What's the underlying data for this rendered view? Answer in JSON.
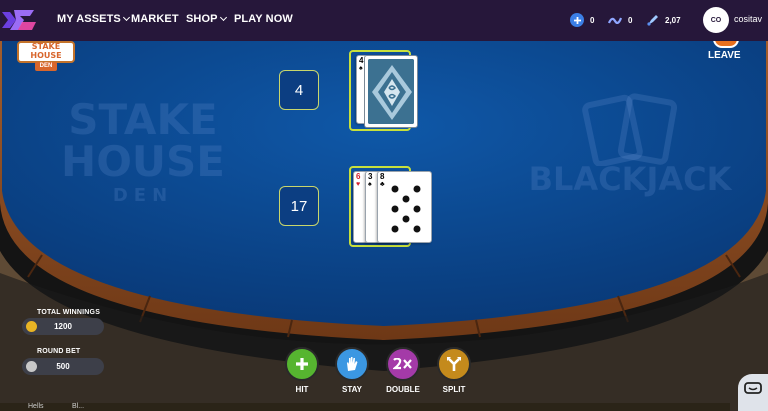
{
  "nav": {
    "items": [
      {
        "label": "MY ASSETS",
        "dropdown": true
      },
      {
        "label": "MARKET",
        "dropdown": false
      },
      {
        "label": "SHOP",
        "dropdown": true
      },
      {
        "label": "PLAY NOW",
        "dropdown": false
      }
    ],
    "stats": [
      {
        "icon": "plus-coin-icon",
        "value": "0"
      },
      {
        "icon": "wave-token-icon",
        "value": "0"
      },
      {
        "icon": "rocket-token-icon",
        "value": "2,07"
      }
    ],
    "avatar_initials": "CO",
    "username": "cositav"
  },
  "table": {
    "left_logo_lines": [
      "STAKE",
      "HOUSE",
      "DEN"
    ],
    "right_logo_text": "BLACKJACK",
    "small_logo_lines": [
      "STAKE",
      "HOUSE",
      "DEN"
    ],
    "leave_label": "LEAVE",
    "dealer": {
      "score": "4",
      "cards": [
        {
          "rank": "4",
          "suit": "♠",
          "color": "#111111",
          "face_down": false
        },
        {
          "face_down": true
        }
      ]
    },
    "player": {
      "score": "17",
      "cards": [
        {
          "rank": "6",
          "suit": "♥",
          "color": "#d41f2b"
        },
        {
          "rank": "3",
          "suit": "♠",
          "color": "#111111"
        },
        {
          "rank": "8",
          "suit": "♣",
          "color": "#111111"
        }
      ]
    }
  },
  "info": {
    "total_winnings_label": "TOTAL WINNINGS",
    "total_winnings_value": "1200",
    "round_bet_label": "ROUND BET",
    "round_bet_value": "500"
  },
  "actions": [
    {
      "label": "HIT",
      "icon": "plus-icon",
      "color": "#56b530"
    },
    {
      "label": "STAY",
      "icon": "hand-icon",
      "color": "#3b97e2"
    },
    {
      "label": "DOUBLE",
      "icon": "2x-icon",
      "color": "#a43aa8"
    },
    {
      "label": "SPLIT",
      "icon": "split-icon",
      "color": "#c48a1c"
    }
  ],
  "footer_text": [
    "Hells",
    "Bl..."
  ],
  "colors": {
    "nav_bg": "#26173a",
    "felt": "#0c4690",
    "rail": "#8a4c22",
    "card_highlight": "#c7e03c"
  }
}
